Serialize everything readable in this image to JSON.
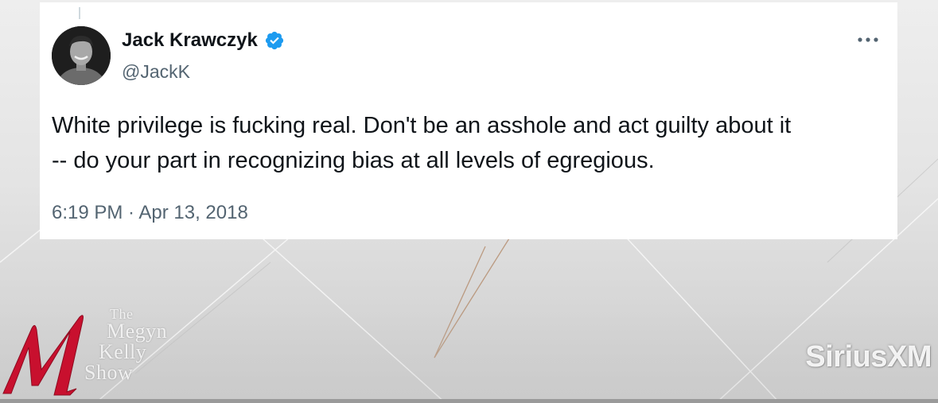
{
  "tweet": {
    "display_name": "Jack Krawczyk",
    "handle": "@JackK",
    "text_line_1": "White privilege is fucking real. Don't be an asshole and act guilty about it",
    "text_line_2": "-- do your part in recognizing bias at all levels of egregious.",
    "timestamp": "6:19 PM · Apr 13, 2018",
    "verified_color": "#1d9bf0",
    "icons": {
      "verified": "verified-badge-icon",
      "more": "more-options-icon",
      "avatar": "avatar-photo"
    }
  },
  "overlay": {
    "show_title_lines": [
      "The",
      "Megyn",
      "Kelly",
      "Show"
    ],
    "show_logo_letter": "M",
    "network_logo": "SiriusXM",
    "logo_accent_color": "#c8102e"
  }
}
